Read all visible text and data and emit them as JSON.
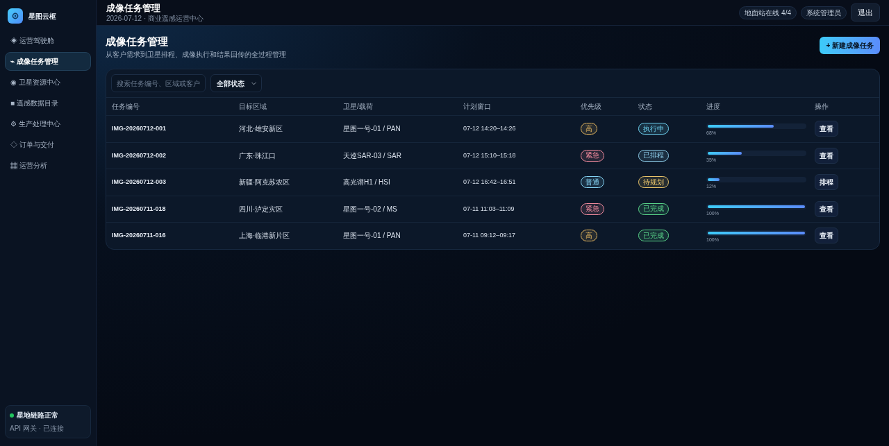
{
  "sidebar": {
    "brand": "星图云枢",
    "items": [
      {
        "label": "◈ 运营驾驶舱",
        "selected": false
      },
      {
        "label": "⌁ 成像任务管理",
        "selected": true
      },
      {
        "label": "◉ 卫星资源中心",
        "selected": false
      },
      {
        "label": "■ 遥感数据目录",
        "selected": false
      },
      {
        "label": "⚙ 生产处理中心",
        "selected": false
      },
      {
        "label": "◇ 订单与交付",
        "selected": false
      },
      {
        "label": "▦ 运营分析",
        "selected": false
      }
    ],
    "link_status": {
      "title": "星地链路正常",
      "detail": "API 网关 · 已连接",
      "ok": true
    }
  },
  "header": {
    "title": "成像任务管理",
    "subtitle": "2026-07-12 · 商业遥感运营中心",
    "badges": [
      "地面站在线 4/4",
      "系统管理员"
    ],
    "logout": "退出"
  },
  "page": {
    "title": "成像任务管理",
    "description": "从客户需求到卫星排程、成像执行和结果回传的全过程管理",
    "primary_action": "+ 新建成像任务"
  },
  "toolbar": {
    "search": {
      "placeholder": "搜索任务编号、区域或客户"
    },
    "status_filter": {
      "value": "全部状态"
    }
  },
  "table": {
    "columns": [
      "任务编号",
      "目标区域",
      "卫星/载荷",
      "计划窗口",
      "优先级",
      "状态",
      "进度",
      "操作"
    ],
    "rows": [
      {
        "id": "IMG-20260712-001",
        "region": "河北·雄安新区",
        "satellite": "星图一号-01 / PAN",
        "window": "07-12 14:20–14:26",
        "priority": {
          "label": "高",
          "color": "#e6b860"
        },
        "status": {
          "label": "执行中",
          "color": "#6fd3f2"
        },
        "level": 0.68,
        "reading": "68%",
        "action": "查看"
      },
      {
        "id": "IMG-20260712-002",
        "region": "广东·珠江口",
        "satellite": "天巡SAR-03 / SAR",
        "window": "07-12 15:10–15:18",
        "priority": {
          "label": "紧急",
          "color": "#f28b9e"
        },
        "status": {
          "label": "已排程",
          "color": "#8ccbe8"
        },
        "level": 0.35,
        "reading": "35%",
        "action": "查看"
      },
      {
        "id": "IMG-20260712-003",
        "region": "新疆·阿克苏农区",
        "satellite": "高光谱H1 / HSI",
        "window": "07-12 16:42–16:51",
        "priority": {
          "label": "普通",
          "color": "#86d4f5"
        },
        "status": {
          "label": "待规划",
          "color": "#e9c46a"
        },
        "level": 0.12,
        "reading": "12%",
        "action": "排程"
      },
      {
        "id": "IMG-20260711-018",
        "region": "四川·泸定灾区",
        "satellite": "星图一号-02 / MS",
        "window": "07-11 11:03–11:09",
        "priority": {
          "label": "紧急",
          "color": "#f28b9e"
        },
        "status": {
          "label": "已完成",
          "color": "#5ad68a"
        },
        "level": 1,
        "reading": "100%",
        "action": "查看"
      },
      {
        "id": "IMG-20260711-016",
        "region": "上海·临港新片区",
        "satellite": "星图一号-01 / PAN",
        "window": "07-11 09:12–09:17",
        "priority": {
          "label": "高",
          "color": "#e6b860"
        },
        "status": {
          "label": "已完成",
          "color": "#5ad68a"
        },
        "level": 1,
        "reading": "100%",
        "action": "查看"
      }
    ]
  }
}
